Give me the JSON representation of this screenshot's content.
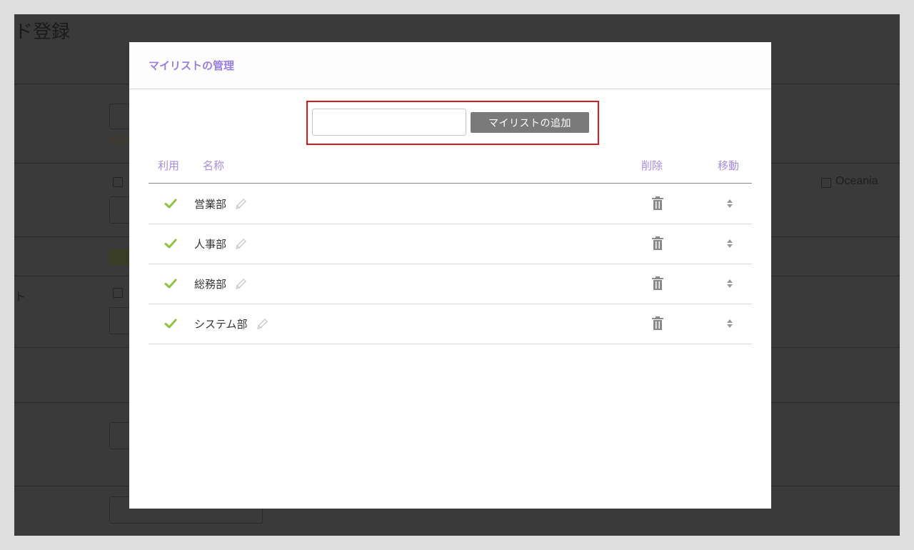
{
  "background_page": {
    "title_fragment": "ド登録",
    "side_label_fragment": "ト",
    "checkbox_option": "Oceania"
  },
  "modal": {
    "title": "マイリストの管理",
    "add_input": {
      "value": "",
      "placeholder": ""
    },
    "add_button_label": "マイリストの追加",
    "columns": {
      "use": "利用",
      "name": "名称",
      "delete": "削除",
      "move": "移動"
    },
    "lists": [
      {
        "name": "営業部",
        "enabled": true
      },
      {
        "name": "人事部",
        "enabled": true
      },
      {
        "name": "総務部",
        "enabled": true
      },
      {
        "name": "システム部",
        "enabled": true
      }
    ]
  },
  "colors": {
    "accent_purple": "#a78de3",
    "check_green": "#8cc43f",
    "highlight_red": "#d91a1a",
    "button_gray": "#7a7a7a"
  },
  "icons": {
    "enabled": "check-icon",
    "edit": "pencil-icon",
    "delete": "trash-icon",
    "move": "sort-icon"
  }
}
